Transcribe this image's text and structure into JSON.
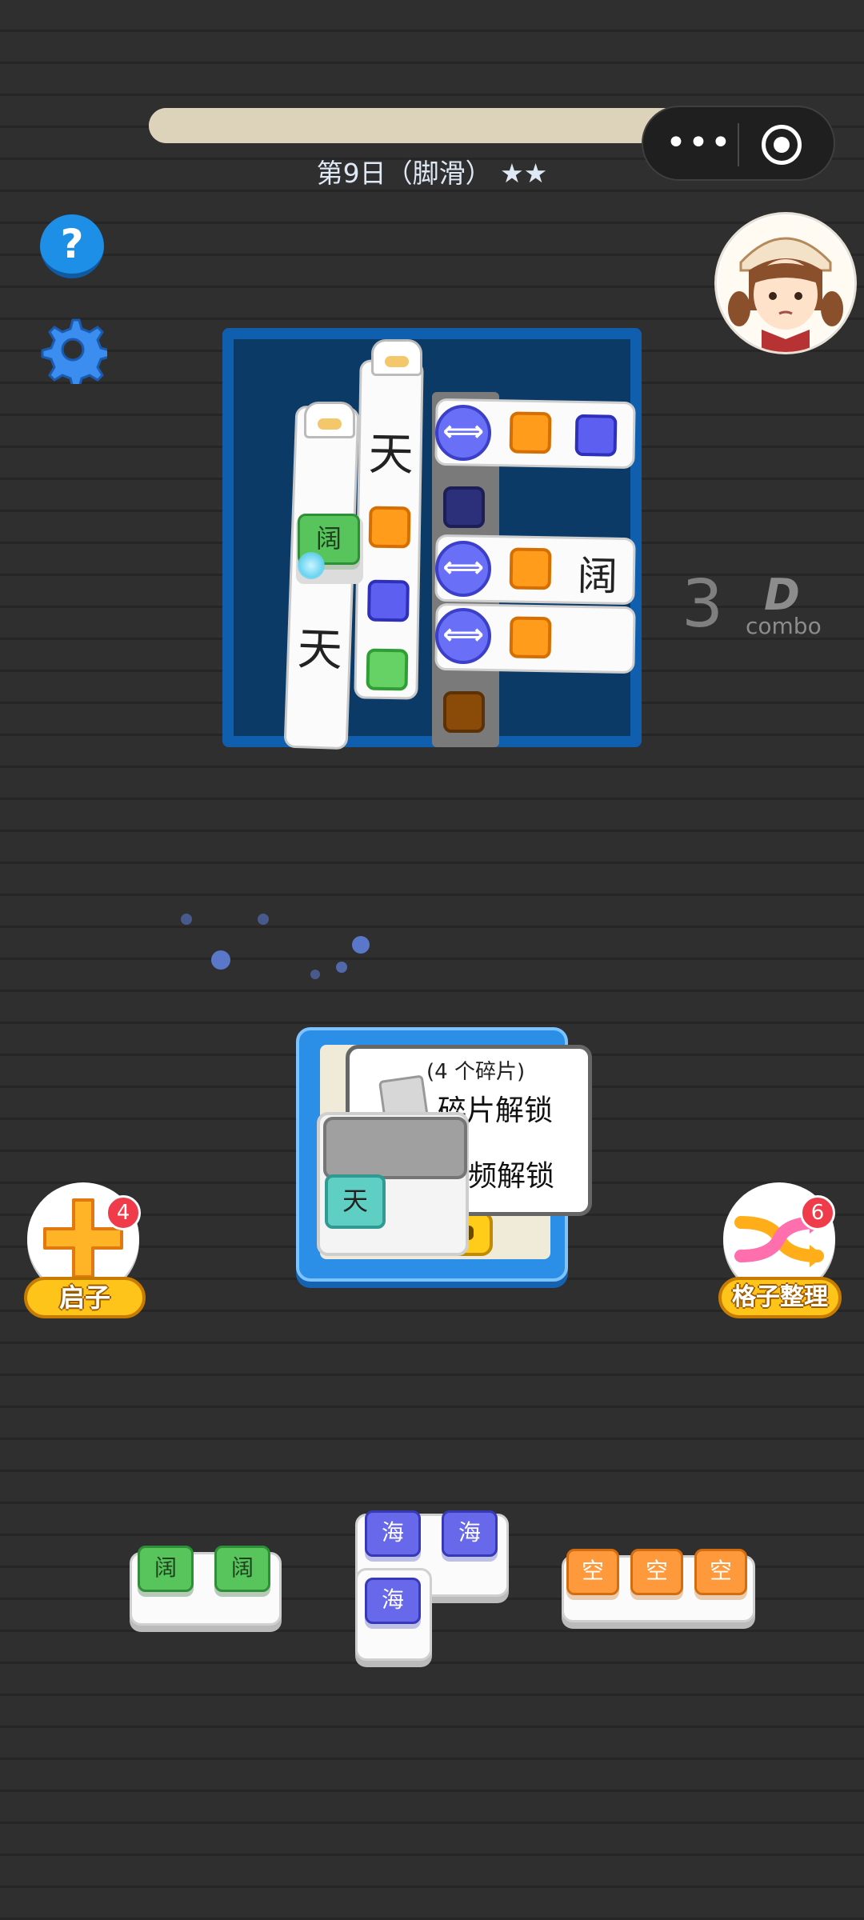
{
  "header": {
    "level_title": "第9日（脚滑） ★★",
    "progress": 0.9
  },
  "capsule": {
    "more_icon": "•••",
    "target_icon": "record-icon"
  },
  "board": {
    "pillar_left_char": "天",
    "pillar_mid_char": "天",
    "left_tile_char": "阔",
    "bar2_char": "阔",
    "arrow_glyph": "⟺"
  },
  "combo": {
    "count": "3",
    "grade": "D",
    "label": "combo"
  },
  "locked_panel": {
    "pieces_text": "(4 个碎片)",
    "line1": "碎片解锁",
    "line2": "频解锁",
    "tile_char": "天"
  },
  "powerups": {
    "add": {
      "label": "启子",
      "badge": "4"
    },
    "shuffle": {
      "label": "格子整理",
      "badge": "6"
    }
  },
  "tray": {
    "piece1": [
      "阔",
      "阔"
    ],
    "piece2": [
      "海",
      "海",
      "海"
    ],
    "piece3": [
      "空",
      "空",
      "空"
    ]
  },
  "colors": {
    "board_frame": "#0f5fae",
    "board_inner": "#0c3a66",
    "accent_blue": "#1e8fe6",
    "badge_red": "#ef3b4a"
  }
}
